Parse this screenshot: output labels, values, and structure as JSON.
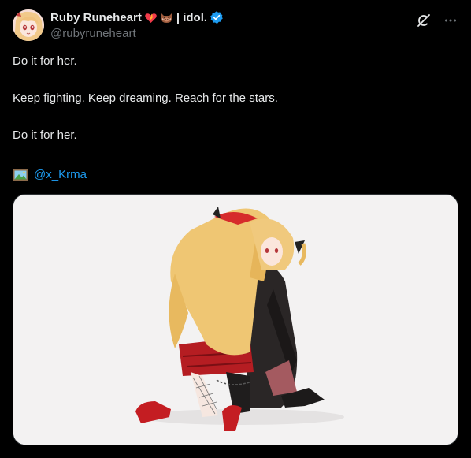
{
  "author": {
    "display_name": "Ruby Runeheart",
    "name_suffix": "| idol.",
    "handle": "@rubyruneheart",
    "emoji_1": "heart-on-fire-emoji",
    "emoji_2": "boar-emoji",
    "verified": true
  },
  "actions": {
    "grok_icon": "grok-icon",
    "more_icon": "more-icon"
  },
  "tweet": {
    "line_1": "Do it for her.",
    "line_2": "Keep fighting. Keep dreaming. Reach for the stars.",
    "line_3": "Do it for her.",
    "credit_icon": "framed-picture-icon",
    "credit_mention": "@x_Krma"
  },
  "media": {
    "description_icon": "anime-illustration-image"
  },
  "colors": {
    "background": "#000000",
    "text": "#e7e9ea",
    "muted": "#71767b",
    "link": "#1d9bf0",
    "verified": "#1d9bf0",
    "media_bg": "#f3f2f2"
  }
}
